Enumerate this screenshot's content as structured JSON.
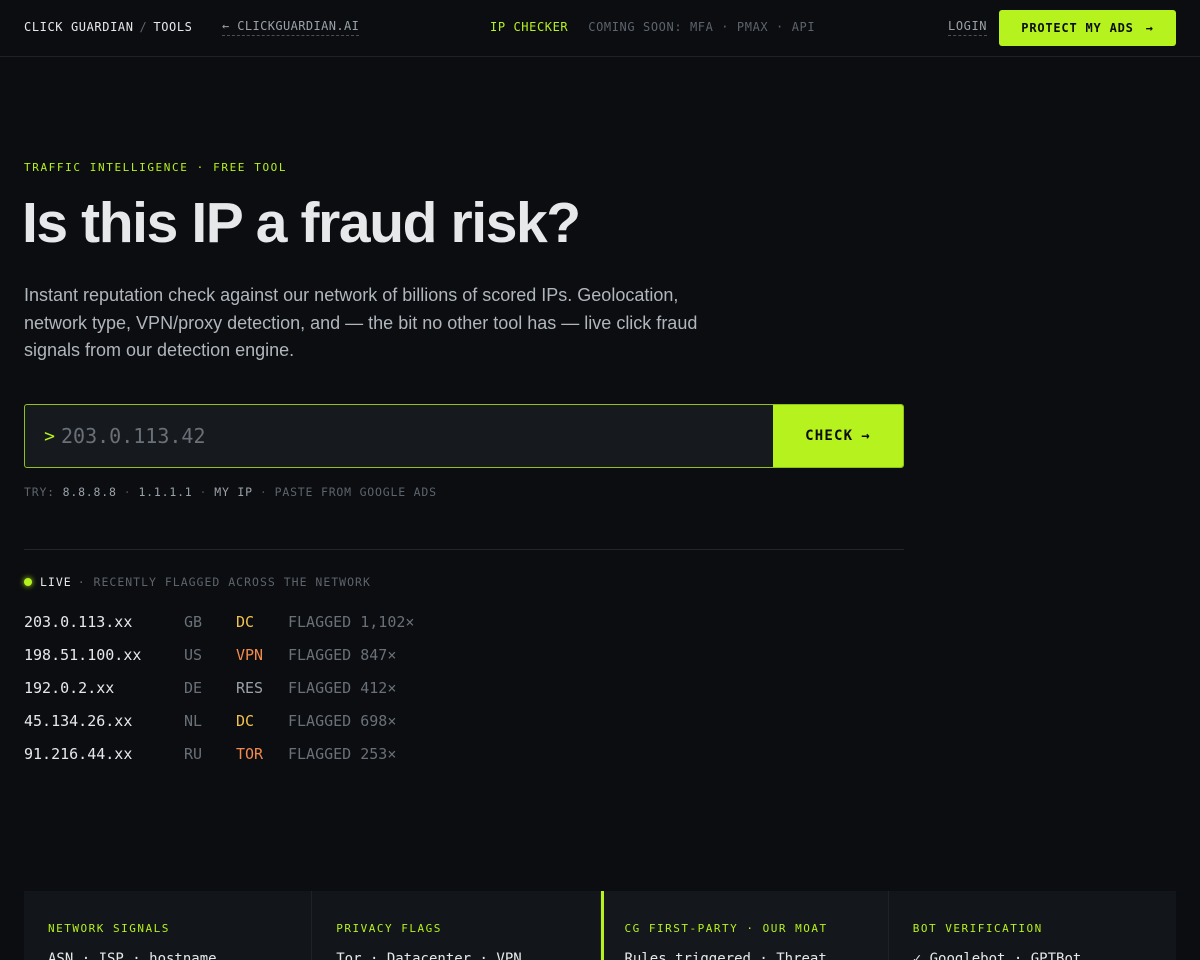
{
  "nav": {
    "brand": "CLICK GUARDIAN",
    "brand_sep": "/",
    "brand_section": "TOOLS",
    "back_link": "← CLICKGUARDIAN.AI",
    "active_tool": "IP CHECKER",
    "coming_soon": "COMING SOON: MFA · PMAX · API",
    "login": "LOGIN",
    "cta_label": "PROTECT MY ADS",
    "cta_arrow": "→"
  },
  "hero": {
    "eyebrow": "TRAFFIC INTELLIGENCE · FREE TOOL",
    "headline": "Is this IP a fraud risk?",
    "lede": "Instant reputation check against our network of billions of scored IPs. Geolocation, network type, VPN/proxy detection, and — the bit no other tool has — live click fraud signals from our detection engine."
  },
  "search": {
    "prompt": ">",
    "placeholder": "203.0.113.42",
    "button_label": "CHECK",
    "button_arrow": "→",
    "try_label": "TRY:",
    "suggestions": [
      "8.8.8.8",
      "1.1.1.1",
      "MY IP",
      "PASTE FROM GOOGLE ADS"
    ]
  },
  "live": {
    "label": "LIVE",
    "caption": "· RECENTLY FLAGGED ACROSS THE NETWORK",
    "rows": [
      {
        "ip": "203.0.113.xx",
        "country": "GB",
        "type": "DC",
        "flagged": "FLAGGED 1,102×"
      },
      {
        "ip": "198.51.100.xx",
        "country": "US",
        "type": "VPN",
        "flagged": "FLAGGED 847×"
      },
      {
        "ip": "192.0.2.xx",
        "country": "DE",
        "type": "RES",
        "flagged": "FLAGGED 412×"
      },
      {
        "ip": "45.134.26.xx",
        "country": "NL",
        "type": "DC",
        "flagged": "FLAGGED 698×"
      },
      {
        "ip": "91.216.44.xx",
        "country": "RU",
        "type": "TOR",
        "flagged": "FLAGGED 253×"
      }
    ]
  },
  "cards": [
    {
      "title": "NETWORK SIGNALS",
      "body": "ASN · ISP · hostname"
    },
    {
      "title": "PRIVACY FLAGS",
      "body": "Tor · Datacenter · VPN"
    },
    {
      "title": "CG FIRST-PARTY · OUR MOAT",
      "body": "Rules triggered · Threat"
    },
    {
      "title": "BOT VERIFICATION",
      "body": "✓ Googlebot · GPTBot"
    }
  ],
  "colors": {
    "accent": "#b6f21d",
    "background": "#0b0d10",
    "type_dc": "#f2c14e",
    "type_vpn": "#f28a4e",
    "type_tor": "#f28a4e",
    "type_res": "#9aa1a8"
  }
}
